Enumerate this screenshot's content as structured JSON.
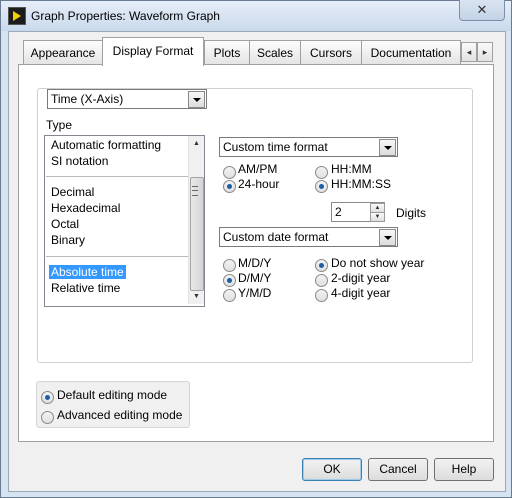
{
  "window": {
    "title": "Graph Properties: Waveform Graph",
    "close_glyph": "✕"
  },
  "tabs": [
    "Appearance",
    "Display Format",
    "Plots",
    "Scales",
    "Cursors",
    "Documentation"
  ],
  "active_tab": "Display Format",
  "tab_scroll": {
    "left": "◂",
    "right": "▸"
  },
  "axis_select": {
    "value": "Time (X-Axis)"
  },
  "type_section": {
    "label": "Type",
    "groups": [
      [
        "Automatic formatting",
        "SI notation"
      ],
      [
        "Decimal",
        "Hexadecimal",
        "Octal",
        "Binary"
      ],
      [
        "Absolute time",
        "Relative time"
      ]
    ],
    "selected": "Absolute time",
    "scroll_up": "▲",
    "scroll_down": "▼"
  },
  "time_format": {
    "value": "Custom time format",
    "radios_left": [
      {
        "label": "AM/PM",
        "checked": false
      },
      {
        "label": "24-hour",
        "checked": true
      }
    ],
    "radios_right": [
      {
        "label": "HH:MM",
        "checked": false
      },
      {
        "label": "HH:MM:SS",
        "checked": true
      }
    ]
  },
  "digits": {
    "value": "2",
    "label": "Digits",
    "up": "▲",
    "down": "▼"
  },
  "date_format": {
    "value": "Custom date format",
    "radios_left": [
      {
        "label": "M/D/Y",
        "checked": false
      },
      {
        "label": "D/M/Y",
        "checked": true
      },
      {
        "label": "Y/M/D",
        "checked": false
      }
    ],
    "radios_right": [
      {
        "label": "Do not show year",
        "checked": true
      },
      {
        "label": "2-digit year",
        "checked": false
      },
      {
        "label": "4-digit year",
        "checked": false
      }
    ]
  },
  "editing_mode": [
    {
      "label": "Default editing mode",
      "checked": true
    },
    {
      "label": "Advanced editing mode",
      "checked": false
    }
  ],
  "buttons": {
    "ok": "OK",
    "cancel": "Cancel",
    "help": "Help"
  }
}
